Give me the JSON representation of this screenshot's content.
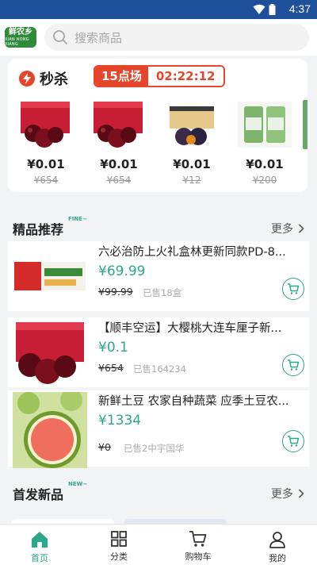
{
  "status_bar": {
    "time": "4:37"
  },
  "header": {
    "logo": {
      "line1": "鲜农乡",
      "line2": "XIAN NONG XIANG"
    },
    "search": {
      "placeholder": "搜索商品"
    }
  },
  "flash_sale": {
    "title": "秒杀",
    "session_label": "15点场",
    "countdown": "02:22:12",
    "items": [
      {
        "price": "¥0.01",
        "original_price": "¥654",
        "image": "cherry-box"
      },
      {
        "price": "¥0.01",
        "original_price": "¥654",
        "image": "cherry-box"
      },
      {
        "price": "¥0.01",
        "original_price": "¥12",
        "image": "plum-box"
      },
      {
        "price": "¥0.01",
        "original_price": "¥200",
        "image": "tea-cans"
      }
    ]
  },
  "featured": {
    "title": "精品推荐",
    "tag": "FINE~",
    "more_label": "更多",
    "products": [
      {
        "name": "六必治防上火礼盒林更新同款PD-8...",
        "price": "¥69.99",
        "original_price": "¥99.99",
        "sold": "已售18盒",
        "image": "toothpaste-box"
      },
      {
        "name": "【顺丰空运】大樱桃大连车厘子新...",
        "price": "¥0.1",
        "original_price": "¥654",
        "sold": "已售164234",
        "image": "cherry-box"
      },
      {
        "name": "新鲜土豆 农家自种蔬菜 应季土豆农...",
        "price": "¥1334",
        "original_price": "¥0",
        "sold": "已售2中宇国华",
        "image": "watermelon"
      }
    ]
  },
  "new_arrivals": {
    "title": "首发新品",
    "tag": "NEW~",
    "more_label": "更多"
  },
  "tab_bar": {
    "tabs": [
      {
        "label": "首页",
        "icon": "home-icon",
        "active": true
      },
      {
        "label": "分类",
        "icon": "grid-icon",
        "active": false
      },
      {
        "label": "购物车",
        "icon": "cart-icon",
        "active": false
      },
      {
        "label": "我的",
        "icon": "user-icon",
        "active": false
      }
    ]
  },
  "colors": {
    "accent": "#2aa88a",
    "sale_red": "#e5452b",
    "status_bar": "#1d4f9a"
  }
}
